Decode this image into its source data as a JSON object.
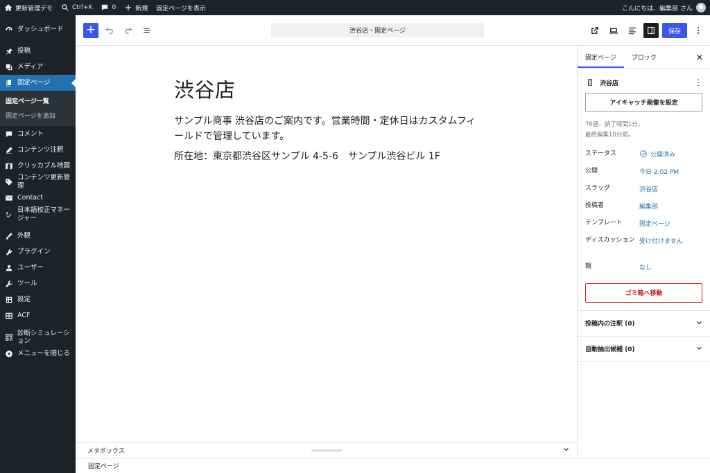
{
  "admin_bar": {
    "site_name": "更新管理デモ",
    "search_shortcut": "Ctrl+K",
    "comments_count": "0",
    "new_label": "新規",
    "view_page_label": "固定ページを表示",
    "greeting": "こんにちは、編集部 さん"
  },
  "sidebar": {
    "items": [
      {
        "label": "ダッシュボード",
        "icon": "dashboard-icon"
      },
      {
        "label": "投稿",
        "icon": "pin-icon"
      },
      {
        "label": "メディア",
        "icon": "media-icon"
      },
      {
        "label": "固定ページ",
        "icon": "pages-icon"
      },
      {
        "label": "コメント",
        "icon": "comment-icon"
      },
      {
        "label": "コンテンツ注釈",
        "icon": "edit-icon"
      },
      {
        "label": "クリッカブル地図",
        "icon": "map-icon"
      },
      {
        "label": "コンテンツ更新管理",
        "icon": "tag-icon"
      },
      {
        "label": "Contact",
        "icon": "mail-icon"
      },
      {
        "label": "日本語校正マネージャー",
        "icon": "spellcheck-icon"
      },
      {
        "label": "外観",
        "icon": "appearance-icon"
      },
      {
        "label": "プラグイン",
        "icon": "plugin-icon"
      },
      {
        "label": "ユーザー",
        "icon": "user-icon"
      },
      {
        "label": "ツール",
        "icon": "wrench-icon"
      },
      {
        "label": "設定",
        "icon": "settings-icon"
      },
      {
        "label": "ACF",
        "icon": "acf-icon"
      },
      {
        "label": "診断シミュレーション",
        "icon": "qr-icon"
      },
      {
        "label": "メニューを閉じる",
        "icon": "collapse-icon"
      }
    ],
    "submenu": [
      "固定ページ一覧",
      "固定ページを追加"
    ]
  },
  "toolbar": {
    "document_title": "渋谷店・固定ページ",
    "save_label": "保存"
  },
  "content": {
    "title": "渋谷店",
    "paragraph1": "サンプル商事 渋谷店のご案内です。営業時間・定休日はカスタムフィールドで管理しています。",
    "paragraph2": "所在地：東京都渋谷区サンプル 4-5-6　サンプル渋谷ビル 1F"
  },
  "metabox_label": "メタボックス",
  "footer_breadcrumb": "固定ページ",
  "settings": {
    "tab_page": "固定ページ",
    "tab_block": "ブロック",
    "panel_title": "渋谷店",
    "featured_image_label": "アイキャッチ画像を設定",
    "word_count": "76語、読了時間1分。",
    "last_edited": "最終編集10分前。",
    "rows": [
      {
        "label": "ステータス",
        "value": "公開済み"
      },
      {
        "label": "公開",
        "value": "今日 2:02 PM"
      },
      {
        "label": "スラッグ",
        "value": "渋谷店"
      },
      {
        "label": "投稿者",
        "value": "編集部"
      },
      {
        "label": "テンプレート",
        "value": "固定ページ"
      },
      {
        "label": "ディスカッション",
        "value": "受け付けません"
      },
      {
        "label": "親",
        "value": "なし"
      }
    ],
    "trash_label": "ゴミ箱へ移動",
    "annotations_label": "投稿内の注釈 (0)",
    "auto_extract_label": "自動抽出候補 (0)"
  },
  "colors": {
    "accent": "#3858e9",
    "admin_dark": "#1d2327",
    "link": "#2271b1",
    "danger": "#cc1818"
  }
}
